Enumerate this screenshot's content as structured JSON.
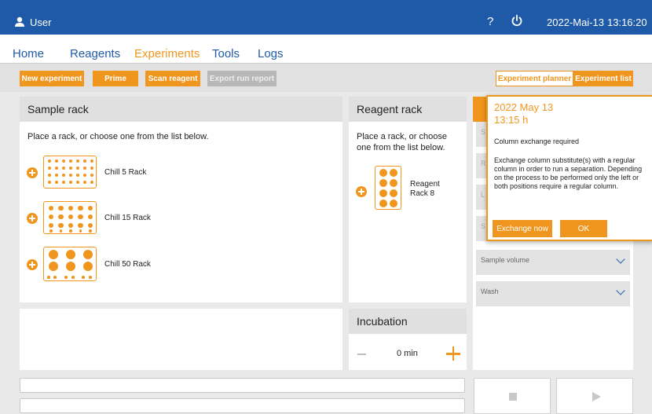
{
  "header": {
    "user": "User",
    "help": "?",
    "date": "2022-Mai-13",
    "time": "13:16:20"
  },
  "nav": [
    "Home",
    "Reagents",
    "Experiments",
    "Tools",
    "Logs"
  ],
  "nav_active": "Experiments",
  "toolbar": {
    "new_experiment": "New experiment",
    "prime": "Prime",
    "scan_reagent": "Scan reagent",
    "export_run_report": "Export run report",
    "experiment_planner": "Experiment planner",
    "experiment_list": "Experiment list"
  },
  "sample_rack": {
    "title": "Sample rack",
    "hint": "Place a rack, or choose one from the list below.",
    "racks": [
      "Chill 5 Rack",
      "Chill 15 Rack",
      "Chill 50 Rack"
    ]
  },
  "reagent_rack": {
    "title": "Reagent rack",
    "hint_line1": "Place a rack, or choose",
    "hint_line2": "one from the list below.",
    "rack_line1": "Reagent",
    "rack_line2": "Rack 8"
  },
  "incubation": {
    "title": "Incubation",
    "value": "0 min"
  },
  "settings": {
    "sample_volume": "Sample volume",
    "wash": "Wash"
  },
  "popup": {
    "date": "2022 May 13",
    "time": "13:15 h",
    "title": "Column exchange required",
    "body": "Exchange column substitute(s) with a regular column in order to run a separation. Depending on the process to be performed only the left or both positions require a regular column.",
    "exchange_now": "Exchange now",
    "ok": "OK"
  },
  "colors": {
    "header_blue": "#1f5aa8",
    "accent_orange": "#f0961e"
  }
}
